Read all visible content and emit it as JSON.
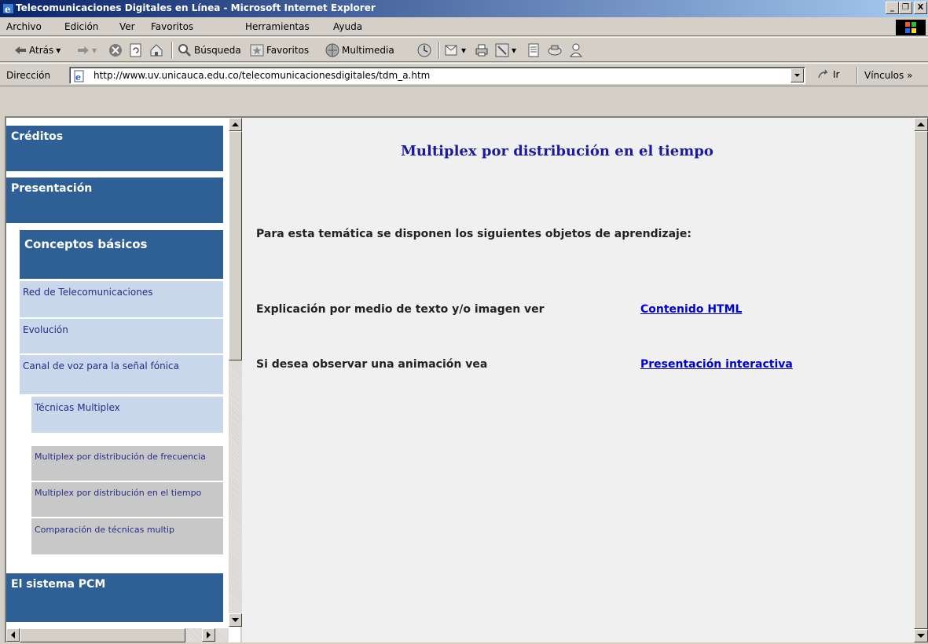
{
  "window": {
    "title": "Telecomunicaciones Digitales en Línea - Microsoft Internet Explorer",
    "minimize": "_",
    "maximize": "❐",
    "close": "X"
  },
  "menu": [
    "Archivo",
    "Edición",
    "Ver",
    "Favoritos",
    "Herramientas",
    "Ayuda"
  ],
  "toolbar": {
    "back": "Atrás",
    "search": "Búsqueda",
    "favorites": "Favoritos",
    "media": "Multimedia"
  },
  "address": {
    "label": "Dirección",
    "url": "http://www.uv.unicauca.edu.co/telecomunicacionesdigitales/tdm_a.htm",
    "go": "Ir",
    "links": "Vínculos »"
  },
  "nav": {
    "creditos": "Créditos",
    "presentacion": "Presentación",
    "conceptos": "Conceptos básicos",
    "red": "Red de Telecomunicaciones",
    "evolucion": "Evolución",
    "canal": "Canal de voz para la señal fónica",
    "tecnicas": "Técnicas Multiplex",
    "fdm": "Multiplex por distribución de frecuencia",
    "tdm": "Multiplex por distribución en el tiempo",
    "comparacion": "Comparación de técnicas multip",
    "pcm": "El sistema PCM"
  },
  "main": {
    "heading": "Multiplex por distribución en el tiempo",
    "intro": "Para esta temática se disponen los siguientes objetos de aprendizaje:",
    "rows": [
      {
        "label": "Explicación por medio de texto y/o imagen ver",
        "link": "Contenido HTML"
      },
      {
        "label": "Si desea observar una animación vea",
        "link": "Presentación interactiva"
      }
    ]
  }
}
